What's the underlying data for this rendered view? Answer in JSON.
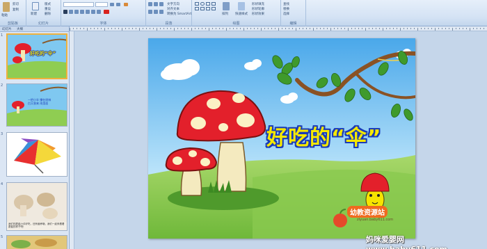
{
  "ribbon": {
    "groups": [
      {
        "label": "剪贴板"
      },
      {
        "label": "幻灯片"
      },
      {
        "label": "字体"
      },
      {
        "label": "段落"
      },
      {
        "label": "绘图"
      },
      {
        "label": "编辑"
      }
    ],
    "paste_label": "粘贴",
    "cut_label": "剪切",
    "copy_label": "复制",
    "new_slide_label": "新建",
    "layout_label": "版式",
    "reset_label": "重设",
    "delete_label": "删除",
    "text_direction_label": "文字方向",
    "align_text_label": "对齐文本",
    "smartart_label": "转换为 SmartArt",
    "arrange_label": "排列",
    "quick_styles_label": "快速样式",
    "shape_fill_label": "形状填充",
    "shape_outline_label": "形状轮廓",
    "shape_effects_label": "形状效果",
    "find_label": "查找",
    "replace_label": "替换",
    "select_label": "选择"
  },
  "panel": {
    "tab_slides": "幻灯片",
    "tab_outline": "大纲",
    "thumbnails": [
      {
        "num": "1",
        "title": "好吃的“伞”"
      },
      {
        "num": "2",
        "text1": "一把小伞",
        "text2": "撑在树林",
        "text3": "白又香来",
        "text4": "雨里面"
      },
      {
        "num": "3"
      },
      {
        "num": "4",
        "caption": "我们的蘑菇小伞好吃，还有营养哦，我们一起来看看蘑菇的样子吧！"
      },
      {
        "num": "5"
      }
    ]
  },
  "slide": {
    "title": "好吃的“伞”",
    "brand": "幼教资源站",
    "brand_url": "ziyuan.baby611.com"
  },
  "watermark": "妈咪爱婴网 www.baby611.com",
  "colors": {
    "sky_top": "#59b4ec",
    "grass": "#7fc24a",
    "mushroom_cap": "#e3202b",
    "title_fill": "#f6e800",
    "title_outline": "#1a3bb8"
  }
}
